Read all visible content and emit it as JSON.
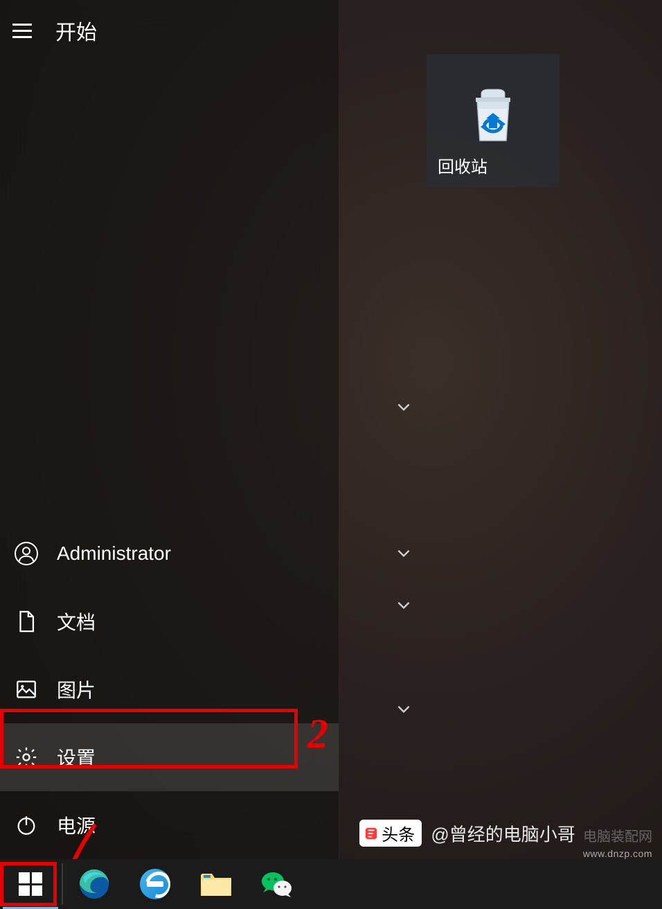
{
  "start": {
    "title": "开始",
    "items": {
      "user": "Administrator",
      "documents": "文档",
      "pictures": "图片",
      "settings": "设置",
      "power": "电源"
    }
  },
  "tiles": {
    "recycle_bin": "回收站"
  },
  "annotations": {
    "step2": "2"
  },
  "watermark": {
    "tag": "头条",
    "author": "@曾经的电脑小哥",
    "site_label": "电脑装配网",
    "site_url": "www.dnzp.com"
  }
}
